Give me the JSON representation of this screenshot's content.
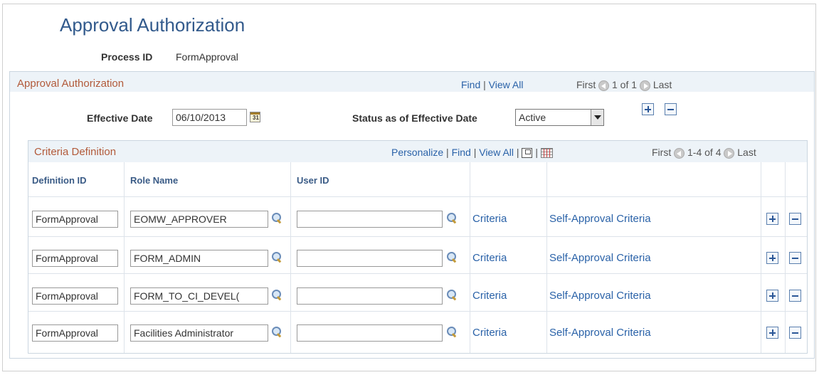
{
  "page": {
    "title": "Approval Authorization",
    "process_id_label": "Process ID",
    "process_id_value": "FormApproval"
  },
  "approval_section": {
    "title": "Approval Authorization",
    "find": "Find",
    "separator": "|",
    "view_all": "View All",
    "first": "First",
    "count": "1 of 1",
    "last": "Last",
    "effective_date_label": "Effective Date",
    "effective_date_value": "06/10/2013",
    "status_label": "Status as of Effective Date",
    "status_value": "Active"
  },
  "criteria_section": {
    "title": "Criteria Definition",
    "personalize": "Personalize",
    "find": "Find",
    "view_all": "View All",
    "separator": "|",
    "first": "First",
    "count": "1-4 of 4",
    "last": "Last",
    "columns": [
      "Definition ID",
      "Role Name",
      "User ID"
    ],
    "rows": [
      {
        "definition_id": "FormApproval",
        "role_name": "EOMW_APPROVER",
        "user_id": "",
        "criteria": "Criteria",
        "self_approval": "Self-Approval Criteria"
      },
      {
        "definition_id": "FormApproval",
        "role_name": "FORM_ADMIN",
        "user_id": "",
        "criteria": "Criteria",
        "self_approval": "Self-Approval Criteria"
      },
      {
        "definition_id": "FormApproval",
        "role_name": "FORM_TO_CI_DEVEL(",
        "user_id": "",
        "criteria": "Criteria",
        "self_approval": "Self-Approval Criteria"
      },
      {
        "definition_id": "FormApproval",
        "role_name": "Facilities Administrator",
        "user_id": "",
        "criteria": "Criteria",
        "self_approval": "Self-Approval Criteria"
      }
    ]
  },
  "icons": {
    "calendar": "calendar-icon",
    "lookup": "lookup-icon",
    "add": "add-row-icon",
    "delete": "delete-row-icon",
    "zoom": "zoom-icon",
    "download": "download-grid-icon",
    "prev": "prev-arrow-icon",
    "next": "next-arrow-icon"
  }
}
